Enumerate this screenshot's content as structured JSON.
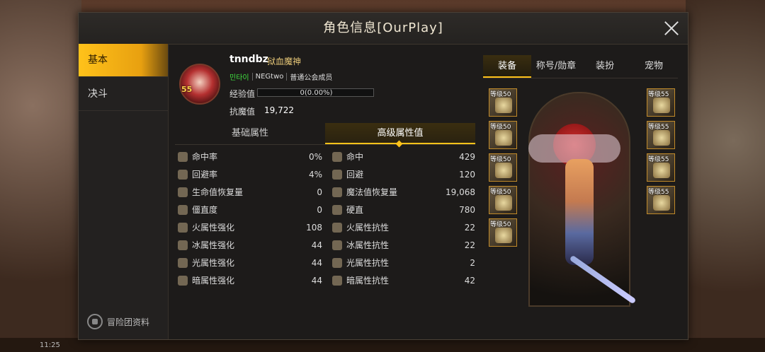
{
  "window": {
    "title": "角色信息[OurPlay]"
  },
  "sidebar": {
    "tabs": [
      {
        "label": "基本",
        "active": true
      },
      {
        "label": "决斗",
        "active": false
      }
    ],
    "footer_label": "冒险团资料"
  },
  "character": {
    "level": "55",
    "name": "tnndbz",
    "class": "狱血魔神",
    "guild": [
      "민타이",
      "NEGtwo",
      "普通公会成员"
    ],
    "exp_label": "经验值",
    "exp_text": "0(0.00%)",
    "exp_fraction": 0,
    "magic_label": "抗魔值",
    "magic_value": "19,722"
  },
  "stat_tabs": [
    {
      "label": "基础属性",
      "active": false
    },
    {
      "label": "高级属性值",
      "active": true
    }
  ],
  "stats_left": [
    {
      "icon": "accuracy-icon",
      "label": "命中率",
      "value": "0%"
    },
    {
      "icon": "evasion-icon",
      "label": "回避率",
      "value": "4%"
    },
    {
      "icon": "hp-regen-icon",
      "label": "生命值恢复量",
      "value": "0"
    },
    {
      "icon": "stiffness-icon",
      "label": "僵直度",
      "value": "0"
    },
    {
      "icon": "fire-icon",
      "label": "火属性强化",
      "value": "108"
    },
    {
      "icon": "ice-icon",
      "label": "冰属性强化",
      "value": "44"
    },
    {
      "icon": "light-icon",
      "label": "光属性强化",
      "value": "44"
    },
    {
      "icon": "dark-icon",
      "label": "暗属性强化",
      "value": "44"
    }
  ],
  "stats_right": [
    {
      "icon": "hit-icon",
      "label": "命中",
      "value": "429"
    },
    {
      "icon": "dodge-icon",
      "label": "回避",
      "value": "120"
    },
    {
      "icon": "mp-regen-icon",
      "label": "魔法值恢复量",
      "value": "19,068"
    },
    {
      "icon": "hard-icon",
      "label": "硬直",
      "value": "780"
    },
    {
      "icon": "fire-resist-icon",
      "label": "火属性抗性",
      "value": "22"
    },
    {
      "icon": "ice-resist-icon",
      "label": "冰属性抗性",
      "value": "22"
    },
    {
      "icon": "light-resist-icon",
      "label": "光属性抗性",
      "value": "2"
    },
    {
      "icon": "dark-resist-icon",
      "label": "暗属性抗性",
      "value": "42"
    }
  ],
  "equip_tabs": [
    {
      "label": "装备",
      "active": true
    },
    {
      "label": "称号/勋章",
      "active": false
    },
    {
      "label": "装扮",
      "active": false
    },
    {
      "label": "宠物",
      "active": false
    }
  ],
  "slots_left": [
    "等级50",
    "等级50",
    "等级50",
    "等级50",
    "等级50"
  ],
  "slots_right": [
    "等级55",
    "等级55",
    "等级55",
    "等级55"
  ],
  "bottom_time": "11:25"
}
